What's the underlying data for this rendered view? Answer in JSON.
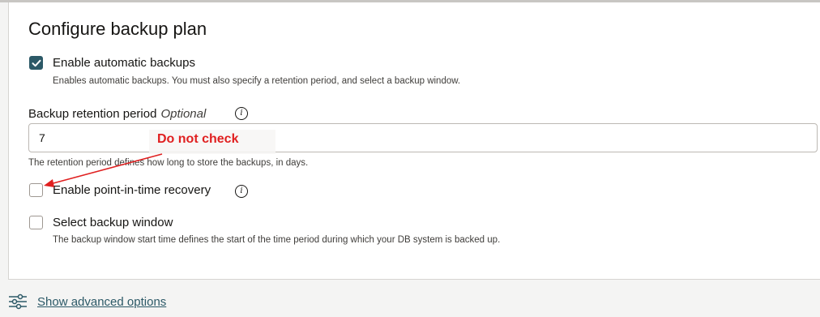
{
  "panel": {
    "title": "Configure backup plan"
  },
  "auto_backups": {
    "checked": true,
    "label": "Enable automatic backups",
    "help": "Enables automatic backups. You must also specify a retention period, and select a backup window."
  },
  "retention": {
    "label": "Backup retention period",
    "optional": "Optional",
    "info_icon": "info-icon",
    "value": "7",
    "help": "The retention period defines how long to store the backups, in days."
  },
  "annotation": {
    "text": "Do not check",
    "color": "#e02020"
  },
  "pitr": {
    "checked": false,
    "label": "Enable point-in-time recovery",
    "info_icon": "info-icon"
  },
  "backup_window": {
    "checked": false,
    "label": "Select backup window",
    "help": "The backup window start time defines the start of the time period during which your DB system is backed up."
  },
  "advanced": {
    "icon": "sliders-icon",
    "link": "Show advanced options"
  },
  "colors": {
    "accent": "#2c5967",
    "annotation": "#e02020"
  }
}
